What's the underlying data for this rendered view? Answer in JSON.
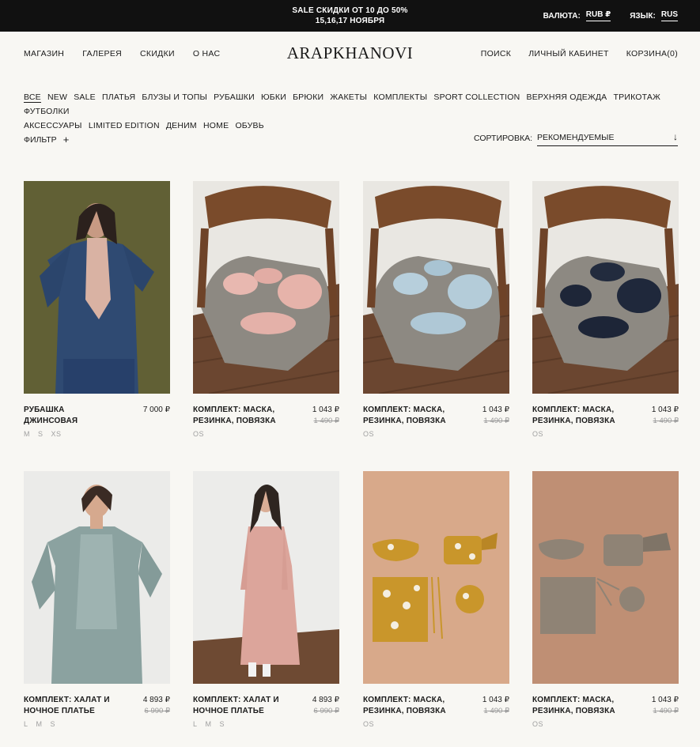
{
  "promo": {
    "line1": "SALE СКИДКИ ОТ 10 ДО 50%",
    "line2": "15,16,17 НОЯБРЯ",
    "currency_label": "ВАЛЮТА:",
    "currency_value": "RUB ₽",
    "language_label": "ЯЗЫК:",
    "language_value": "RUS"
  },
  "header": {
    "logo": "ARAPKHANOVI",
    "nav_left": [
      "МАГАЗИН",
      "ГАЛЕРЕЯ",
      "СКИДКИ",
      "О НАС"
    ],
    "nav_right": [
      "ПОИСК",
      "ЛИЧНЫЙ КАБИНЕТ",
      "КОРЗИНА(0)"
    ]
  },
  "categories": [
    "ВСЕ",
    "NEW",
    "SALE",
    "ПЛАТЬЯ",
    "БЛУЗЫ И ТОПЫ",
    "РУБАШКИ",
    "ЮБКИ",
    "БРЮКИ",
    "ЖАКЕТЫ",
    "КОМПЛЕКТЫ",
    "SPORT COLLECTION",
    "ВЕРХНЯЯ ОДЕЖДА",
    "ТРИКОТАЖ",
    "ФУТБОЛКИ",
    "АКСЕССУАРЫ",
    "LIMITED EDITION",
    "ДЕНИМ",
    "HOME",
    "ОБУВЬ"
  ],
  "filter": {
    "label": "ФИЛЬТР",
    "icon": "plus-icon"
  },
  "sort": {
    "label": "СОРТИРОВКА:",
    "value": "РЕКОМЕНДУЕМЫЕ",
    "icon": "arrow-down-icon"
  },
  "products": [
    {
      "name": "РУБАШКА ДЖИНСОВАЯ",
      "price": "7 000 ₽",
      "old_price": "",
      "sizes": [
        "M",
        "S",
        "XS"
      ],
      "image": "denim-model"
    },
    {
      "name": "КОМПЛЕКТ: МАСКА, РЕЗИНКА, ПОВЯЗКА",
      "price": "1 043 ₽",
      "old_price": "1 490 ₽",
      "sizes": [
        "OS"
      ],
      "image": "chair-pink"
    },
    {
      "name": "КОМПЛЕКТ: МАСКА, РЕЗИНКА, ПОВЯЗКА",
      "price": "1 043 ₽",
      "old_price": "1 490 ₽",
      "sizes": [
        "OS"
      ],
      "image": "chair-blue"
    },
    {
      "name": "КОМПЛЕКТ: МАСКА, РЕЗИНКА, ПОВЯЗКА",
      "price": "1 043 ₽",
      "old_price": "1 490 ₽",
      "sizes": [
        "OS"
      ],
      "image": "chair-navy"
    },
    {
      "name": "КОМПЛЕКТ: ХАЛАТ И НОЧНОЕ ПЛАТЬЕ",
      "price": "4 893 ₽",
      "old_price": "6 990 ₽",
      "sizes": [
        "L",
        "M",
        "S"
      ],
      "image": "robe-green"
    },
    {
      "name": "КОМПЛЕКТ: ХАЛАТ И НОЧНОЕ ПЛАТЬЕ",
      "price": "4 893 ₽",
      "old_price": "6 990 ₽",
      "sizes": [
        "L",
        "M",
        "S"
      ],
      "image": "robe-pink"
    },
    {
      "name": "КОМПЛЕКТ: МАСКА, РЕЗИНКА, ПОВЯЗКА",
      "price": "1 043 ₽",
      "old_price": "1 490 ₽",
      "sizes": [
        "OS"
      ],
      "image": "flat-mustard"
    },
    {
      "name": "КОМПЛЕКТ: МАСКА, РЕЗИНКА, ПОВЯЗКА",
      "price": "1 043 ₽",
      "old_price": "1 490 ₽",
      "sizes": [
        "OS"
      ],
      "image": "flat-grey"
    }
  ],
  "colors": {
    "background": "#f8f7f3",
    "promo_bar": "#111111",
    "muted": "#9a9a9a"
  }
}
